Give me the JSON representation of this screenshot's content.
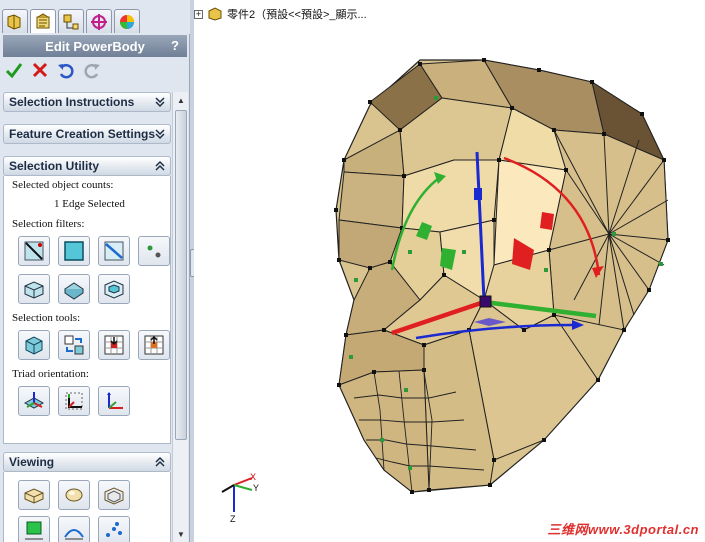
{
  "tabs": [
    {
      "name": "feature-manager-icon"
    },
    {
      "name": "property-manager-icon"
    },
    {
      "name": "configuration-manager-icon"
    },
    {
      "name": "dimxpert-icon"
    },
    {
      "name": "display-manager-icon"
    }
  ],
  "property_manager": {
    "title": "Edit PowerBody",
    "help_label": "?",
    "actions": [
      "ok-check-icon",
      "cancel-x-icon",
      "undo-icon",
      "redo-icon"
    ]
  },
  "groups": {
    "selection_instructions": "Selection Instructions",
    "feature_creation_settings": "Feature Creation Settings",
    "selection_utility": "Selection Utility",
    "viewing": "Viewing"
  },
  "selection_utility": {
    "counts_label": "Selected object counts:",
    "counts_value": "1 Edge Selected",
    "filters_label": "Selection filters:",
    "tools_label": "Selection tools:",
    "triad_label": "Triad orientation:"
  },
  "tree": {
    "breadcrumb": "零件2（預設<<預設>_顯示..."
  },
  "triad_axes": {
    "x": "X",
    "y": "Y",
    "z": "Z"
  },
  "watermark": "三维网www.3dportal.cn",
  "colors": {
    "face": "#d9c38f",
    "face_light": "#f2e1b2",
    "face_dark": "#9e8558",
    "accent_red": "#e02020",
    "accent_green": "#30b030",
    "accent_blue": "#1a2ad0",
    "header": "#7f8fa6"
  }
}
